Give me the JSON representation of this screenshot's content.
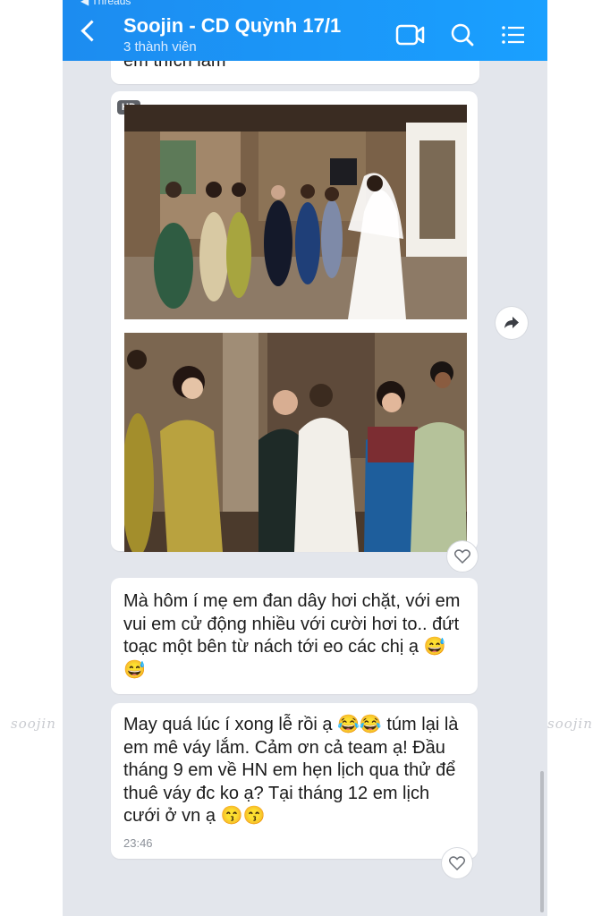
{
  "watermark": {
    "left": "soojin",
    "right": "soojin"
  },
  "status_bar": {
    "back_app": "◀ Threads"
  },
  "header": {
    "title": "Soojin - CD Quỳnh 17/1",
    "subtitle": "3 thành viên",
    "icons": [
      "back-icon",
      "video-call-icon",
      "search-icon",
      "menu-list-icon"
    ],
    "accent_color": "#1a95f5"
  },
  "messages": [
    {
      "type": "text-partial",
      "text": "em thích lắm"
    },
    {
      "type": "image-group",
      "badge": "HD",
      "images": [
        "bride-photo-1",
        "bride-photo-2"
      ]
    },
    {
      "type": "text",
      "text": "Mà hôm í mẹ em đan dây hơi chặt, với em vui em cử động nhiều với cười hơi to.. đứt toạc một bên từ nách tới eo các chị ạ 😅😅"
    },
    {
      "type": "text",
      "text": "May quá lúc í xong lễ rồi ạ 😂😂 túm lại là em mê váy lắm. Cảm ơn cả team ạ! Đầu tháng 9 em về HN em hẹn lịch qua thử để thuê váy đc ko ạ? Tại tháng 12 em lịch cưới ở vn ạ 😙😙",
      "time": "23:46"
    }
  ]
}
